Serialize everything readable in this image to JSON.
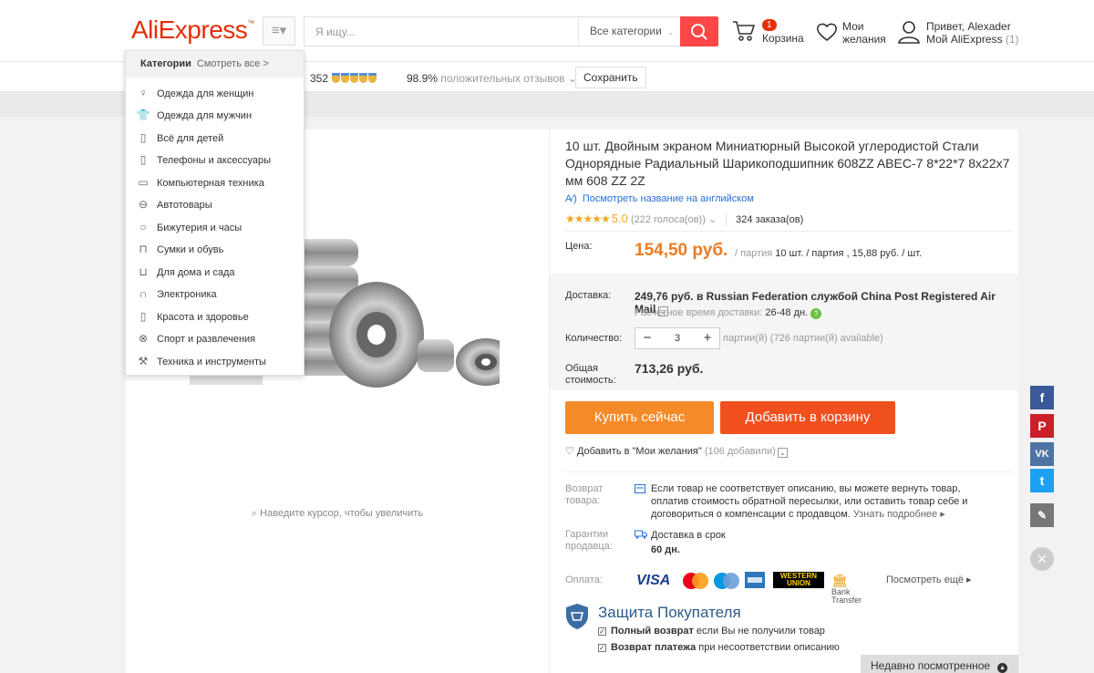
{
  "header": {
    "logo": {
      "part1": "Ali",
      "part2": "Express"
    },
    "search_placeholder": "Я ищу...",
    "search_category": "Все категории",
    "cart_count": "1",
    "cart_label": "Корзина",
    "wish_line1": "Мои",
    "wish_line2": "желания",
    "greeting": "Привет, Alexader",
    "my_account": "Мой AliExpress",
    "account_count": "(1)"
  },
  "store": {
    "rating_num": "352",
    "positive_pct": "98.9%",
    "positive_text": "положительных отзывов",
    "save_label": "Сохранить"
  },
  "categories": {
    "title": "Категории",
    "see_all": "Смотреть все >",
    "items": [
      {
        "label": "Одежда для женщин",
        "icon": "dress-icon"
      },
      {
        "label": "Одежда для мужчин",
        "icon": "shirt-icon"
      },
      {
        "label": "Всё для детей",
        "icon": "bottle-icon"
      },
      {
        "label": "Телефоны и аксессуары",
        "icon": "phone-icon"
      },
      {
        "label": "Компьютерная техника",
        "icon": "laptop-icon"
      },
      {
        "label": "Автотовары",
        "icon": "car-icon"
      },
      {
        "label": "Бижутерия и часы",
        "icon": "ring-icon"
      },
      {
        "label": "Сумки и обувь",
        "icon": "bag-icon"
      },
      {
        "label": "Для дома и сада",
        "icon": "sofa-icon"
      },
      {
        "label": "Электроника",
        "icon": "headphones-icon"
      },
      {
        "label": "Красота и здоровье",
        "icon": "lipstick-icon"
      },
      {
        "label": "Спорт и развлечения",
        "icon": "ball-icon"
      },
      {
        "label": "Техника и инструменты",
        "icon": "tool-icon"
      }
    ]
  },
  "gallery": {
    "zoom_hint": "Наведите курсор, чтобы увеличить"
  },
  "product": {
    "title": "10 шт. Двойным экраном Миниатюрный Высокой углеродистой Стали Однорядные Радиальный Шарикоподшипник 608ZZ ABEC-7 8*22*7 8x22x7 мм 608 ZZ 2Z",
    "english_link": "Посмотреть название на английском",
    "rating": "5.0",
    "votes": "(222 голоса(ов))",
    "orders": "324 заказа(ов)",
    "price_label": "Цена:",
    "price": "154,50 руб.",
    "price_unit_pre": "/ партия",
    "price_unit_detail": "10 шт. / партия , 15,88 руб. / шт.",
    "shipping_label": "Доставка:",
    "shipping_value": "249,76 руб. в Russian Federation службой China Post Registered Air Mail",
    "delivery_time_label": "Расчётное время доставки:",
    "delivery_time": "26-48 дн.",
    "qty_label": "Количество:",
    "qty_value": "3",
    "qty_avail": "партии(й) (726 партии(й) available)",
    "total_label_1": "Общая",
    "total_label_2": "стоимость:",
    "total_value": "713,26 руб.",
    "buy_now": "Купить сейчас",
    "add_to_cart": "Добавить в корзину",
    "add_wish": "Добавить в \"Мои желания\"",
    "wish_count": "(106 добавили)",
    "return_label_1": "Возврат",
    "return_label_2": "товара:",
    "return_text": "Если товар не соответствует описанию, вы можете вернуть товар, оплатив стоимость обратной пересылки, или оставить товар себе и договориться о компенсации с продавцом.",
    "return_more": "Узнать подробнее",
    "guarantee_label_1": "Гарантии",
    "guarantee_label_2": "продавца:",
    "guarantee_line1": "Доставка в срок",
    "guarantee_line2": "60 дн.",
    "payment_label": "Оплата:",
    "payment_more": "Посмотреть ещё",
    "payments": {
      "visa": "VISA",
      "western_1": "WESTERN",
      "western_2": "UNION",
      "bank_1": "Bank",
      "bank_2": "Transfer"
    }
  },
  "protection": {
    "title": "Защита Покупателя",
    "line1_bold": "Полный возврат",
    "line1_rest": "если Вы не получили товар",
    "line2_bold": "Возврат платежа",
    "line2_rest": "при несоответствии описанию"
  },
  "recent": {
    "label": "Недавно посмотренное"
  },
  "colors": {
    "brand": "#e62e04",
    "buy": "#f58a28",
    "cart": "#f1501e",
    "price": "#f07b1f"
  }
}
